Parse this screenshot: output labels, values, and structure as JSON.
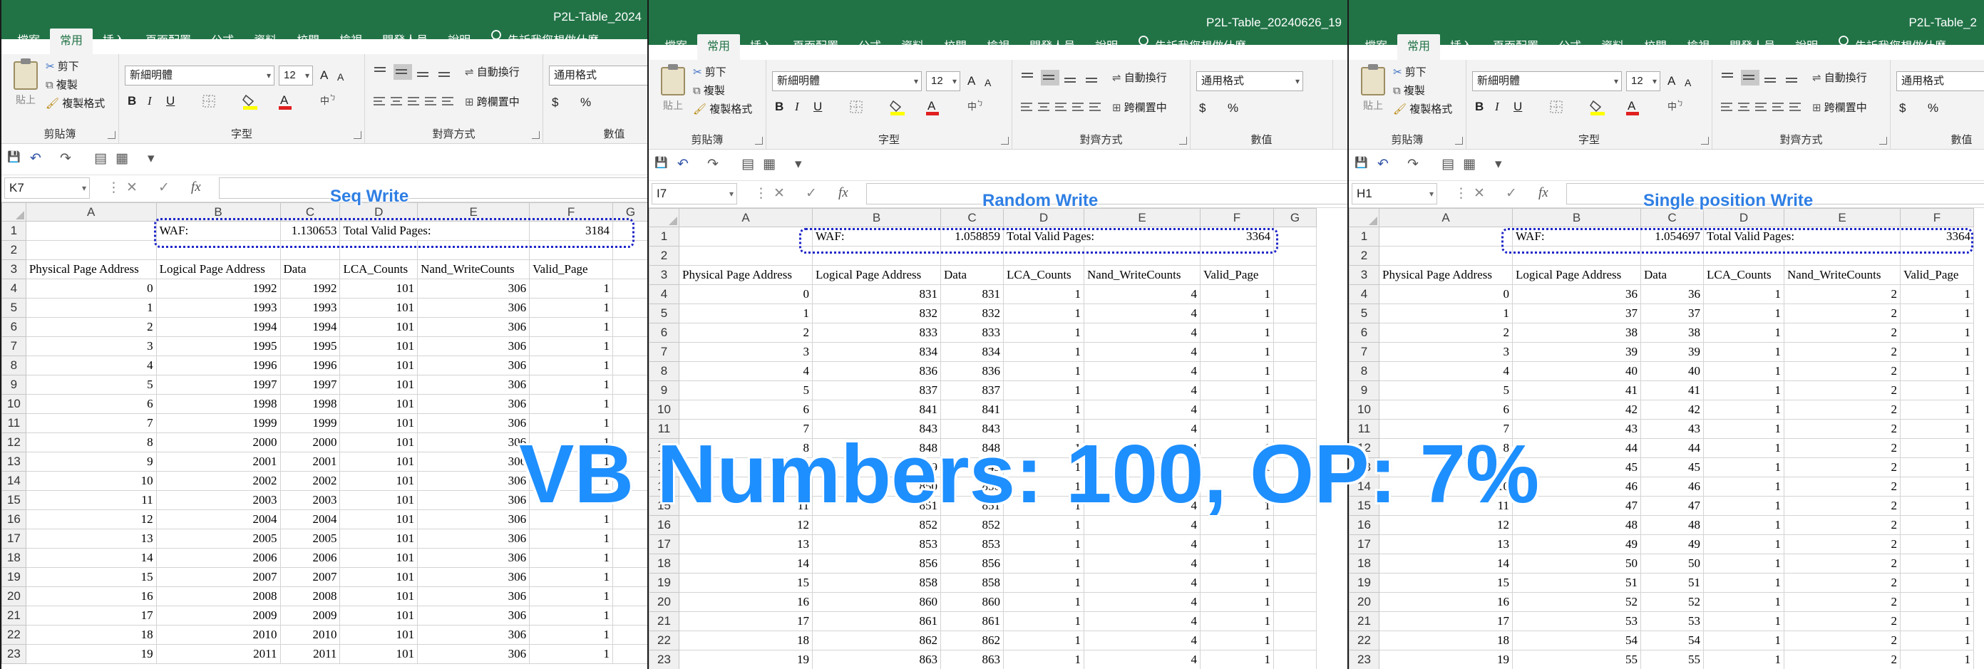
{
  "tabs": [
    "檔案",
    "常用",
    "插入",
    "頁面配置",
    "公式",
    "資料",
    "校閱",
    "檢視",
    "開發人員",
    "說明"
  ],
  "active_tab": "常用",
  "tell_me": "告訴我您想做什麼",
  "ribbon": {
    "clipboard": {
      "paste": "貼上",
      "cut": "剪下",
      "copy": "複製",
      "format_painter": "複製格式",
      "label": "剪貼簿"
    },
    "font": {
      "name": "新細明體",
      "size": "12",
      "label": "字型",
      "bold": "B",
      "italic": "I",
      "underline": "U",
      "grow": "A",
      "shrink": "A"
    },
    "alignment": {
      "wrap": "自動換行",
      "merge": "跨欄置中",
      "label": "對齊方式"
    },
    "number": {
      "format": "通用格式",
      "label": "數值",
      "currency": "$",
      "percent": "%"
    }
  },
  "column_headers": [
    "A",
    "B",
    "C",
    "D",
    "E",
    "F",
    "G"
  ],
  "fx": "fx",
  "overlay_text": "VB Numbers: 100, OP: 7%",
  "windows": [
    {
      "title": "P2L-Table_2024",
      "name_box": "K7",
      "sheet_label": "Seq Write",
      "waf_label": "WAF:",
      "waf": "1.130653",
      "tvp_label": "Total Valid Pages:",
      "tvp": "3184",
      "headers": [
        "Physical Page Address",
        "Logical Page Address",
        "Data",
        "LCA_Counts",
        "Nand_WriteCounts",
        "Valid_Page"
      ],
      "rows": [
        [
          "0",
          "1992",
          "1992",
          "101",
          "306",
          "1"
        ],
        [
          "1",
          "1993",
          "1993",
          "101",
          "306",
          "1"
        ],
        [
          "2",
          "1994",
          "1994",
          "101",
          "306",
          "1"
        ],
        [
          "3",
          "1995",
          "1995",
          "101",
          "306",
          "1"
        ],
        [
          "4",
          "1996",
          "1996",
          "101",
          "306",
          "1"
        ],
        [
          "5",
          "1997",
          "1997",
          "101",
          "306",
          "1"
        ],
        [
          "6",
          "1998",
          "1998",
          "101",
          "306",
          "1"
        ],
        [
          "7",
          "1999",
          "1999",
          "101",
          "306",
          "1"
        ],
        [
          "8",
          "2000",
          "2000",
          "101",
          "306",
          "1"
        ],
        [
          "9",
          "2001",
          "2001",
          "101",
          "306",
          "1"
        ],
        [
          "10",
          "2002",
          "2002",
          "101",
          "306",
          "1"
        ],
        [
          "11",
          "2003",
          "2003",
          "101",
          "306",
          "1"
        ],
        [
          "12",
          "2004",
          "2004",
          "101",
          "306",
          "1"
        ],
        [
          "13",
          "2005",
          "2005",
          "101",
          "306",
          "1"
        ],
        [
          "14",
          "2006",
          "2006",
          "101",
          "306",
          "1"
        ],
        [
          "15",
          "2007",
          "2007",
          "101",
          "306",
          "1"
        ],
        [
          "16",
          "2008",
          "2008",
          "101",
          "306",
          "1"
        ],
        [
          "17",
          "2009",
          "2009",
          "101",
          "306",
          "1"
        ],
        [
          "18",
          "2010",
          "2010",
          "101",
          "306",
          "1"
        ],
        [
          "19",
          "2011",
          "2011",
          "101",
          "306",
          "1"
        ]
      ]
    },
    {
      "title": "P2L-Table_20240626_19",
      "name_box": "I7",
      "sheet_label": "Random Write",
      "waf_label": "WAF:",
      "waf": "1.058859",
      "tvp_label": "Total Valid Pages:",
      "tvp": "3364",
      "headers": [
        "Physical Page Address",
        "Logical Page Address",
        "Data",
        "LCA_Counts",
        "Nand_WriteCounts",
        "Valid_Page"
      ],
      "rows": [
        [
          "0",
          "831",
          "831",
          "1",
          "4",
          "1"
        ],
        [
          "1",
          "832",
          "832",
          "1",
          "4",
          "1"
        ],
        [
          "2",
          "833",
          "833",
          "1",
          "4",
          "1"
        ],
        [
          "3",
          "834",
          "834",
          "1",
          "4",
          "1"
        ],
        [
          "4",
          "836",
          "836",
          "1",
          "4",
          "1"
        ],
        [
          "5",
          "837",
          "837",
          "1",
          "4",
          "1"
        ],
        [
          "6",
          "841",
          "841",
          "1",
          "4",
          "1"
        ],
        [
          "7",
          "843",
          "843",
          "1",
          "4",
          "1"
        ],
        [
          "8",
          "848",
          "848",
          "1",
          "4",
          "1"
        ],
        [
          "9",
          "849",
          "849",
          "1",
          "4",
          "1"
        ],
        [
          "10",
          "850",
          "850",
          "1",
          "4",
          "1"
        ],
        [
          "11",
          "851",
          "851",
          "1",
          "4",
          "1"
        ],
        [
          "12",
          "852",
          "852",
          "1",
          "4",
          "1"
        ],
        [
          "13",
          "853",
          "853",
          "1",
          "4",
          "1"
        ],
        [
          "14",
          "856",
          "856",
          "1",
          "4",
          "1"
        ],
        [
          "15",
          "858",
          "858",
          "1",
          "4",
          "1"
        ],
        [
          "16",
          "860",
          "860",
          "1",
          "4",
          "1"
        ],
        [
          "17",
          "861",
          "861",
          "1",
          "4",
          "1"
        ],
        [
          "18",
          "862",
          "862",
          "1",
          "4",
          "1"
        ],
        [
          "19",
          "863",
          "863",
          "1",
          "4",
          "1"
        ]
      ]
    },
    {
      "title": "P2L-Table_2",
      "name_box": "H1",
      "sheet_label": "Single position Write",
      "waf_label": "WAF:",
      "waf": "1.054697",
      "tvp_label": "Total Valid Pages:",
      "tvp": "3364",
      "headers": [
        "Physical Page Address",
        "Logical Page Address",
        "Data",
        "LCA_Counts",
        "Nand_WriteCounts",
        "Valid_Page"
      ],
      "rows": [
        [
          "0",
          "36",
          "36",
          "1",
          "2",
          "1"
        ],
        [
          "1",
          "37",
          "37",
          "1",
          "2",
          "1"
        ],
        [
          "2",
          "38",
          "38",
          "1",
          "2",
          "1"
        ],
        [
          "3",
          "39",
          "39",
          "1",
          "2",
          "1"
        ],
        [
          "4",
          "40",
          "40",
          "1",
          "2",
          "1"
        ],
        [
          "5",
          "41",
          "41",
          "1",
          "2",
          "1"
        ],
        [
          "6",
          "42",
          "42",
          "1",
          "2",
          "1"
        ],
        [
          "7",
          "43",
          "43",
          "1",
          "2",
          "1"
        ],
        [
          "8",
          "44",
          "44",
          "1",
          "2",
          "1"
        ],
        [
          "9",
          "45",
          "45",
          "1",
          "2",
          "1"
        ],
        [
          "10",
          "46",
          "46",
          "1",
          "2",
          "1"
        ],
        [
          "11",
          "47",
          "47",
          "1",
          "2",
          "1"
        ],
        [
          "12",
          "48",
          "48",
          "1",
          "2",
          "1"
        ],
        [
          "13",
          "49",
          "49",
          "1",
          "2",
          "1"
        ],
        [
          "14",
          "50",
          "50",
          "1",
          "2",
          "1"
        ],
        [
          "15",
          "51",
          "51",
          "1",
          "2",
          "1"
        ],
        [
          "16",
          "52",
          "52",
          "1",
          "2",
          "1"
        ],
        [
          "17",
          "53",
          "53",
          "1",
          "2",
          "1"
        ],
        [
          "18",
          "54",
          "54",
          "1",
          "2",
          "1"
        ],
        [
          "19",
          "55",
          "55",
          "1",
          "2",
          "1"
        ]
      ]
    }
  ]
}
